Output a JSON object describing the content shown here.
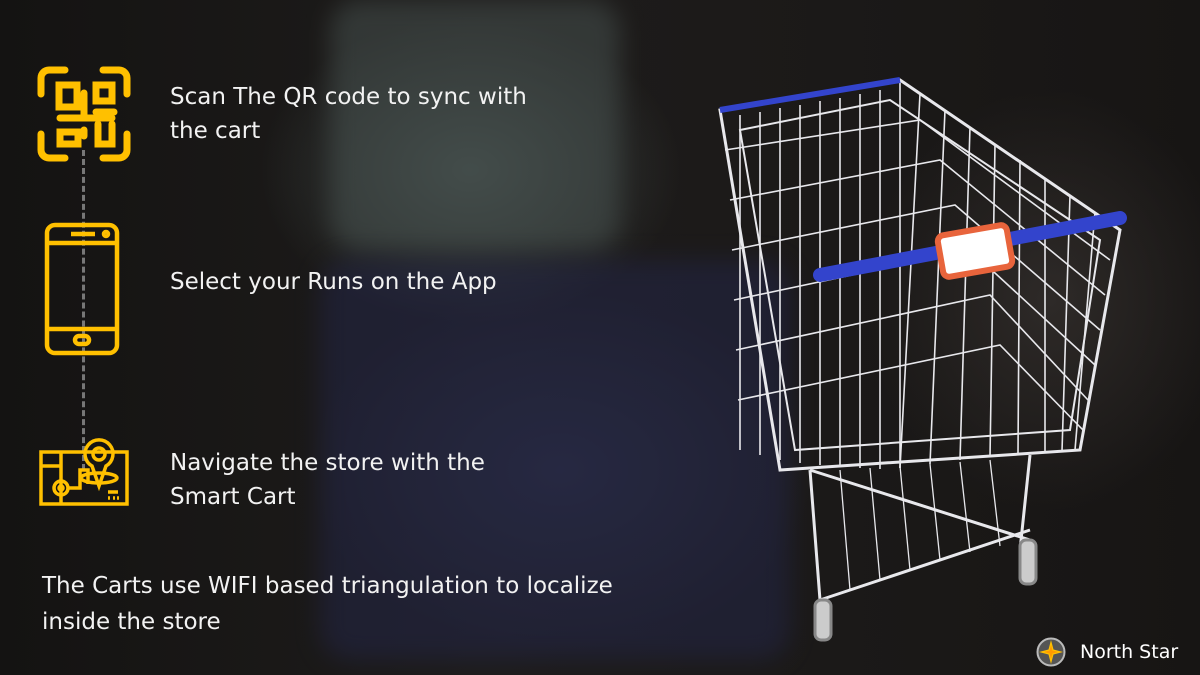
{
  "steps": [
    {
      "icon": "qr-code-icon",
      "text_line1": "Scan The QR code to sync with",
      "text_line2": "the cart"
    },
    {
      "icon": "smartphone-icon",
      "text_line1": "Select your Runs on the App"
    },
    {
      "icon": "store-map-pin-icon",
      "text_line1": "Navigate the store with the",
      "text_line2": "Smart Cart"
    }
  ],
  "note": {
    "line1": "The Carts use WIFI based triangulation to localize",
    "line2": "inside the store"
  },
  "brand": {
    "name": "North Star",
    "icon": "compass-star-icon"
  },
  "colors": {
    "accent": "#FFC000",
    "cart_handle": "#3344CC",
    "cart_tag": "#E8643C"
  }
}
